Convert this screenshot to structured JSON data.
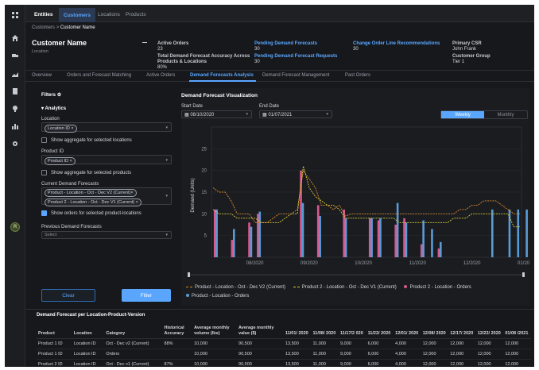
{
  "colors": {
    "accent": "#5aa6ff",
    "bar_blue": "#5b9bd5",
    "bar_pink": "#d9588e",
    "line_orange": "#e08a2c",
    "line_yellow": "#d9c93c",
    "line_red": "#e04a3f"
  },
  "rail": {
    "icons": [
      "app-grid-icon",
      "home-icon",
      "truck-icon",
      "chart-line-icon",
      "document-icon",
      "bulb-icon",
      "chart-bars-icon",
      "gear-icon"
    ],
    "avatar": "R"
  },
  "top_tabs": [
    "Entities",
    "Customers",
    "Locations",
    "Products"
  ],
  "breadcrumb": {
    "parent": "Customers",
    "sep": ">",
    "current": "Customer Name"
  },
  "header": {
    "name": "Customer Name",
    "location": "Location",
    "active_orders_label": "Active Orders",
    "active_orders": "23",
    "accuracy_label": "Total Demand Forecast Accuracy Across Products & Locations",
    "accuracy": "80%",
    "pending_label": "Pending Demand Forecasts",
    "pending": "30",
    "pending_req_label": "Pending Demand Forecast Requests",
    "pending_req": "30",
    "change_label": "Change Order Line Recommendations",
    "change": "30",
    "csr_label": "Primary CSR",
    "csr": "John Frank",
    "group_label": "Customer Group",
    "group": "Tier 1"
  },
  "sub_tabs": [
    "Overview",
    "Orders and Forecast Matching",
    "Active Orders",
    "Demand Forecasts Analysis",
    "Demand Forecast Management",
    "Past Orders"
  ],
  "filters": {
    "title": "Filters",
    "section": "Analytics",
    "location_label": "Location",
    "location_chip": "Location ID",
    "loc_agg": "Show aggregate for selected locations",
    "product_label": "Product ID",
    "product_chip": "Product ID",
    "prod_agg": "Show aggregate for selected products",
    "current_label": "Current Demand Forecasts",
    "current_chip1": "Product - Location - Oct - Dec V2 (Current)",
    "current_chip2": "Product 2 - Location - Oct - Dec V1 (Current)",
    "show_orders": "Show orders for selected product-locations",
    "previous_label": "Previous Demand Forecasts",
    "previous_placeholder": "Select",
    "clear": "Clear",
    "filter": "Filter"
  },
  "viz": {
    "title": "Demand Forecast Visualization",
    "start_label": "Start Date",
    "start": "08/10/2020",
    "end_label": "End Date",
    "end": "01/07/2021",
    "weekly": "Weekly",
    "monthly": "Monthly"
  },
  "chart_data": {
    "type": "bar",
    "ylabel": "Demand (Units)",
    "ylim": [
      0,
      30
    ],
    "yticks": [
      5,
      10,
      15,
      20,
      25
    ],
    "xticks": [
      "08/2020",
      "09/2020",
      "10/2020",
      "11/2020",
      "12/2020",
      "01/2021"
    ],
    "series": [
      {
        "name": "Product - Location - Oct - Dec V2 (Current)",
        "kind": "line",
        "values": [
          16,
          15,
          15,
          13,
          10,
          10,
          10,
          8,
          8,
          8,
          9,
          10,
          10,
          10,
          11,
          20,
          18,
          16,
          12,
          12,
          11,
          12,
          9.5,
          10,
          10,
          10,
          10,
          10,
          10,
          10,
          10,
          10,
          10,
          10,
          10,
          10,
          10,
          10,
          10,
          10,
          10,
          11,
          11,
          12,
          12,
          13,
          13,
          13,
          12,
          11,
          10,
          10
        ]
      },
      {
        "name": "Product 2 - Location - Oct - Dec V1 (Current)",
        "kind": "line",
        "values": [
          11,
          10,
          10,
          10,
          9,
          9,
          9,
          9,
          8,
          8,
          8,
          8,
          9,
          10,
          10,
          21,
          16,
          14,
          13,
          12,
          12,
          11,
          9,
          9,
          9,
          9,
          9,
          9,
          9,
          9,
          9,
          8,
          8,
          8,
          8,
          8,
          8,
          8,
          8,
          8,
          9,
          9,
          9,
          10,
          10,
          10,
          10,
          10,
          10,
          10,
          7,
          7
        ]
      },
      {
        "name": "Product 2 - Location - Orders",
        "kind": "bar",
        "values": [
          11,
          null,
          4,
          null,
          8,
          10,
          null,
          null,
          null,
          null,
          20,
          null,
          12,
          null,
          null,
          11,
          null,
          null,
          9,
          8.5,
          null,
          7.5,
          9,
          null,
          3,
          null,
          2,
          null,
          null,
          null,
          null,
          null,
          null,
          null,
          null
        ]
      },
      {
        "name": "Product - Location - Orders",
        "kind": "bar",
        "values": [
          11,
          null,
          6.5,
          null,
          7,
          10.5,
          null,
          null,
          null,
          null,
          12.5,
          null,
          9.5,
          null,
          null,
          9,
          null,
          null,
          9,
          9,
          null,
          12.5,
          8,
          null,
          8.5,
          6.5,
          3.5,
          null,
          null,
          null,
          null,
          null,
          11,
          null,
          11,
          11,
          11
        ]
      }
    ]
  },
  "table": {
    "title": "Demand Forecast per Location-Product-Version",
    "headers": [
      "Product",
      "Location",
      "Category",
      "Historical Accuracy",
      "Average monthly volume (lbs)",
      "Average monthly value ($)",
      "11/01/ 2020",
      "11/08/ 2020",
      "11/17/2 020",
      "11/22/ 2020",
      "12/01/ 2020",
      "12/08/ 2020",
      "12/17/ 2020",
      "12/22/ 2020",
      "01/08 /2021"
    ],
    "rows": [
      [
        "Product 1 ID",
        "Location ID",
        "Oct - Dec v2 (Current)",
        "88%",
        "10,000",
        "90,500",
        "13,500",
        "11,000",
        "9,000",
        "6,000",
        "4,000",
        "12,000",
        "12,000",
        "12,000",
        "12,000"
      ],
      [
        "Product 1 ID",
        "Location ID",
        "Orders",
        "",
        "10,000",
        "90,500",
        "13,500",
        "11,000",
        "9,000",
        "6,000",
        "4,000",
        "12,000",
        "12,000",
        "12,000",
        "12,000"
      ],
      [
        "Product 2 ID",
        "Location ID",
        "Oct - Dec v1 (Current)",
        "87%",
        "10,000",
        "90,500",
        "13,500",
        "11,000",
        "9,000",
        "6,000",
        "4,000",
        "12,000",
        "12,000",
        "12,000",
        "12,000"
      ]
    ]
  }
}
